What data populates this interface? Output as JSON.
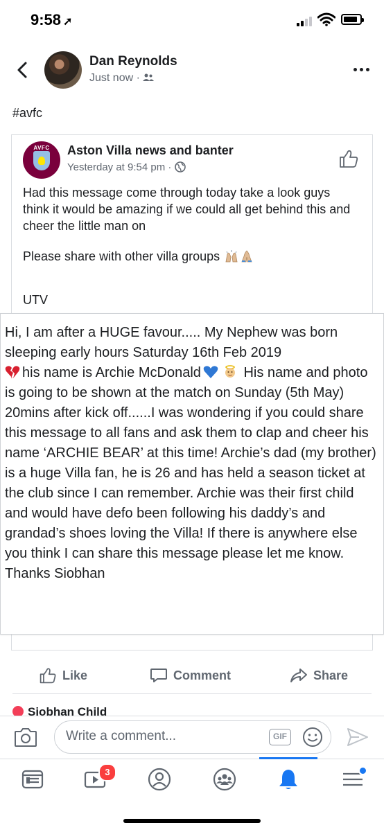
{
  "status_bar": {
    "time": "9:58",
    "location_arrow": "location-arrow-icon",
    "battery_level": 0.85
  },
  "post": {
    "author": "Dan Reynolds",
    "meta": "Just now",
    "privacy_icon": "friends-icon",
    "text": "#avfc"
  },
  "shared_post": {
    "page_name": "Aston Villa news and banter",
    "crest_text": "AVFC",
    "meta": "Yesterday at 9:54 pm",
    "privacy_icon": "globe-icon",
    "paragraph_1": "Had this message come through today take a look guys think it would be amazing if we could all get behind this and cheer the little man on",
    "paragraph_2": "Please share with other villa groups",
    "paragraph_3": "UTV",
    "message": {
      "part_1": "Hi, I am after a HUGE favour..... My Nephew was born sleeping early hours Saturday 16th Feb 2019",
      "part_2": "his name is Archie McDonald",
      "part_3": "His name and photo is going to be shown at the match on Sunday (5th May) 20mins after kick off......I was wondering if you could share this message to all fans and ask them to clap and cheer his name ‘ARCHIE BEAR’ at this time! Archie’s dad (my brother) is a huge Villa fan, he is 26 and has held a season ticket at the club since I can remember. Archie was their first child and would have defo been following his daddy’s and grandad’s shoes loving the Villa! If there is anywhere else you think I can share this message please let me know.\nThanks Siobhan"
    }
  },
  "actions": {
    "like": "Like",
    "comment": "Comment",
    "share": "Share"
  },
  "reactions": {
    "name": "Siobhan Child"
  },
  "composer": {
    "placeholder": "Write a comment...",
    "gif_label": "GIF"
  },
  "tab_bar": {
    "video_badge": "3"
  },
  "colors": {
    "accent": "#1877f2",
    "villa_claret": "#7a003c",
    "villa_blue": "#95bfe5"
  }
}
